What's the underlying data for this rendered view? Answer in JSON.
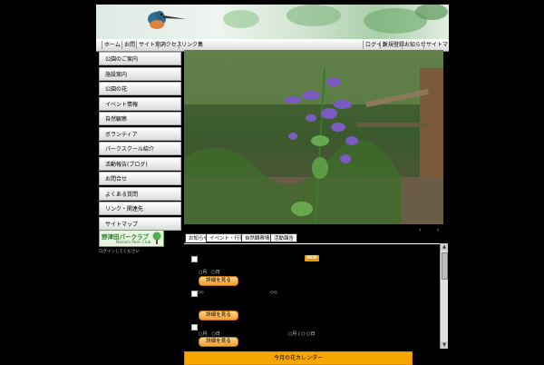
{
  "banner": {
    "logo_icon": "kingfisher-icon"
  },
  "topnav": {
    "left": [
      "ホーム",
      "お問",
      "サイト案内",
      "アクセス",
      "リンク集"
    ],
    "right": [
      "ログイン",
      "新規登録",
      "お知らせ",
      "サイトマップ"
    ]
  },
  "sidebar": {
    "items": [
      "公園のご案内",
      "施設案内",
      "公園の花",
      "イベント情報",
      "自然観察",
      "ボランティア",
      "パークスクール紹介",
      "活動報告(ブログ)",
      "お問合せ",
      "よくある質問",
      "リンク・関連先",
      "サイトマップ"
    ]
  },
  "logo": {
    "title": "野津田パークラブ",
    "sub": "Nozuta Park Club"
  },
  "login_line": "ログインしてください",
  "photo": {
    "prev": "‹",
    "next": "›"
  },
  "tabs": [
    "お知らせ",
    "イベント・行事予定",
    "自然観察情報",
    "活動報告"
  ],
  "news": {
    "badge": "NEW",
    "date1": "○月　○日",
    "detail_label": "詳細を見る",
    "diamonds": [
      "◇◇",
      "◇◇"
    ],
    "row3_left": "○月　○日",
    "row3_right": "○月 / ○ ○日"
  },
  "bottom_bar": "今月の花カレンダー",
  "colors": {
    "accent": "#f7a600",
    "brand_green": "#2e7d32"
  }
}
